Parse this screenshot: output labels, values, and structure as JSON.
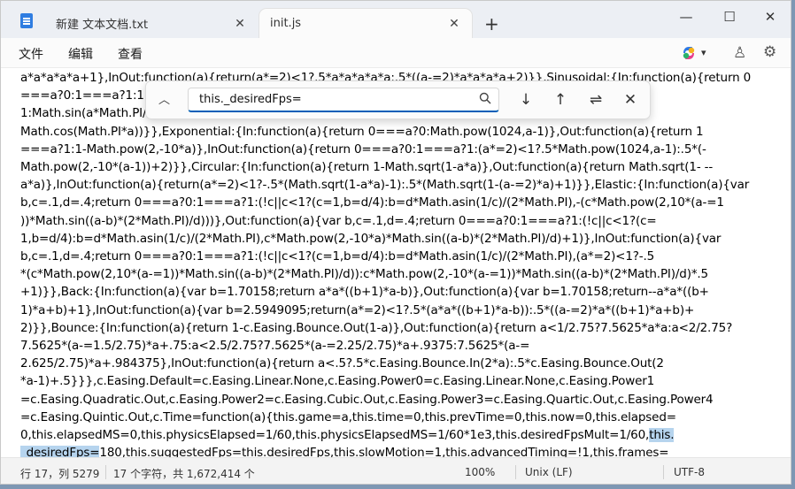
{
  "tabs": [
    {
      "label": "新建 文本文档.txt",
      "active": false
    },
    {
      "label": "init.js",
      "active": true
    }
  ],
  "titlebar": {
    "new_tab": "+",
    "minimize": "—",
    "maximize": "☐",
    "close": "✕"
  },
  "menu": {
    "file": "文件",
    "edit": "编辑",
    "view": "查看"
  },
  "find": {
    "query": "this._desiredFps=",
    "toggle_glyph": "︿",
    "prev_glyph": "↓",
    "next_glyph": "↑",
    "options_glyph": "⇌",
    "close_glyph": "✕"
  },
  "editor": {
    "lines": [
      "a*a*a*a*a+1},InOut:function(a){return(a*=2)<1?.5*a*a*a*a*a:.5*((a-=2)*a*a*a*a+2)}},Sinusoidal:{In:function(a){return 0",
      "===a?0:1===a?1:1",
      "1:Math.sin(a*Math.PI/2)}},",
      "Math.cos(Math.PI*a))}},Exponential:{In:function(a){return 0===a?0:Math.pow(1024,a-1)},Out:function(a){return 1",
      "===a?1:1-Math.pow(2,-10*a)},InOut:function(a){return 0===a?0:1===a?1:(a*=2)<1?.5*Math.pow(1024,a-1):.5*(-",
      "Math.pow(2,-10*(a-1))+2)}},Circular:{In:function(a){return 1-Math.sqrt(1-a*a)},Out:function(a){return Math.sqrt(1- --",
      "a*a)},InOut:function(a){return(a*=2)<1?-.5*(Math.sqrt(1-a*a)-1):.5*(Math.sqrt(1-(a-=2)*a)+1)}},Elastic:{In:function(a){var",
      "b,c=.1,d=.4;return 0===a?0:1===a?1:(!c||c<1?(c=1,b=d/4):b=d*Math.asin(1/c)/(2*Math.PI),-(c*Math.pow(2,10*(a-=1",
      "))*Math.sin((a-b)*(2*Math.PI)/d)))},Out:function(a){var b,c=.1,d=.4;return 0===a?0:1===a?1:(!c||c<1?(c=",
      "1,b=d/4):b=d*Math.asin(1/c)/(2*Math.PI),c*Math.pow(2,-10*a)*Math.sin((a-b)*(2*Math.PI)/d)+1)},InOut:function(a){var",
      "b,c=.1,d=.4;return 0===a?0:1===a?1:(!c||c<1?(c=1,b=d/4):b=d*Math.asin(1/c)/(2*Math.PI),(a*=2)<1?-.5",
      "*(c*Math.pow(2,10*(a-=1))*Math.sin((a-b)*(2*Math.PI)/d)):c*Math.pow(2,-10*(a-=1))*Math.sin((a-b)*(2*Math.PI)/d)*.5",
      "+1)}},Back:{In:function(a){var b=1.70158;return a*a*((b+1)*a-b)},Out:function(a){var b=1.70158;return--a*a*((b+",
      "1)*a+b)+1},InOut:function(a){var b=2.5949095;return(a*=2)<1?.5*(a*a*((b+1)*a-b)):.5*((a-=2)*a*((b+1)*a+b)+",
      "2)}},Bounce:{In:function(a){return 1-c.Easing.Bounce.Out(1-a)},Out:function(a){return a<1/2.75?7.5625*a*a:a<2/2.75?",
      "7.5625*(a-=1.5/2.75)*a+.75:a<2.5/2.75?7.5625*(a-=2.25/2.75)*a+.9375:7.5625*(a-=",
      "2.625/2.75)*a+.984375},InOut:function(a){return a<.5?.5*c.Easing.Bounce.In(2*a):.5*c.Easing.Bounce.Out(2",
      "*a-1)+.5}}},c.Easing.Default=c.Easing.Linear.None,c.Easing.Power0=c.Easing.Linear.None,c.Easing.Power1",
      "=c.Easing.Quadratic.Out,c.Easing.Power2=c.Easing.Cubic.Out,c.Easing.Power3=c.Easing.Quartic.Out,c.Easing.Power4",
      "=c.Easing.Quintic.Out,c.Time=function(a){this.game=a,this.time=0,this.prevTime=0,this.now=0,this.elapsed=",
      "0,this.elapsedMS=0,this.physicsElapsed=1/60,this.physicsElapsedMS=1/60*1e3,this.desiredFpsMult=1/60,",
      "180,this.suggestedFps=this.desiredFps,this.slowMotion=1,this.advancedTiming=!1,this.frames="
    ],
    "highlight_a": "this.",
    "highlight_b": "_desiredFps="
  },
  "status": {
    "position": "行 17，列 5279",
    "selection": "17 个字符，共 1,672,414 个",
    "zoom": "100%",
    "line_ending": "Unix (LF)",
    "encoding": "UTF-8"
  }
}
